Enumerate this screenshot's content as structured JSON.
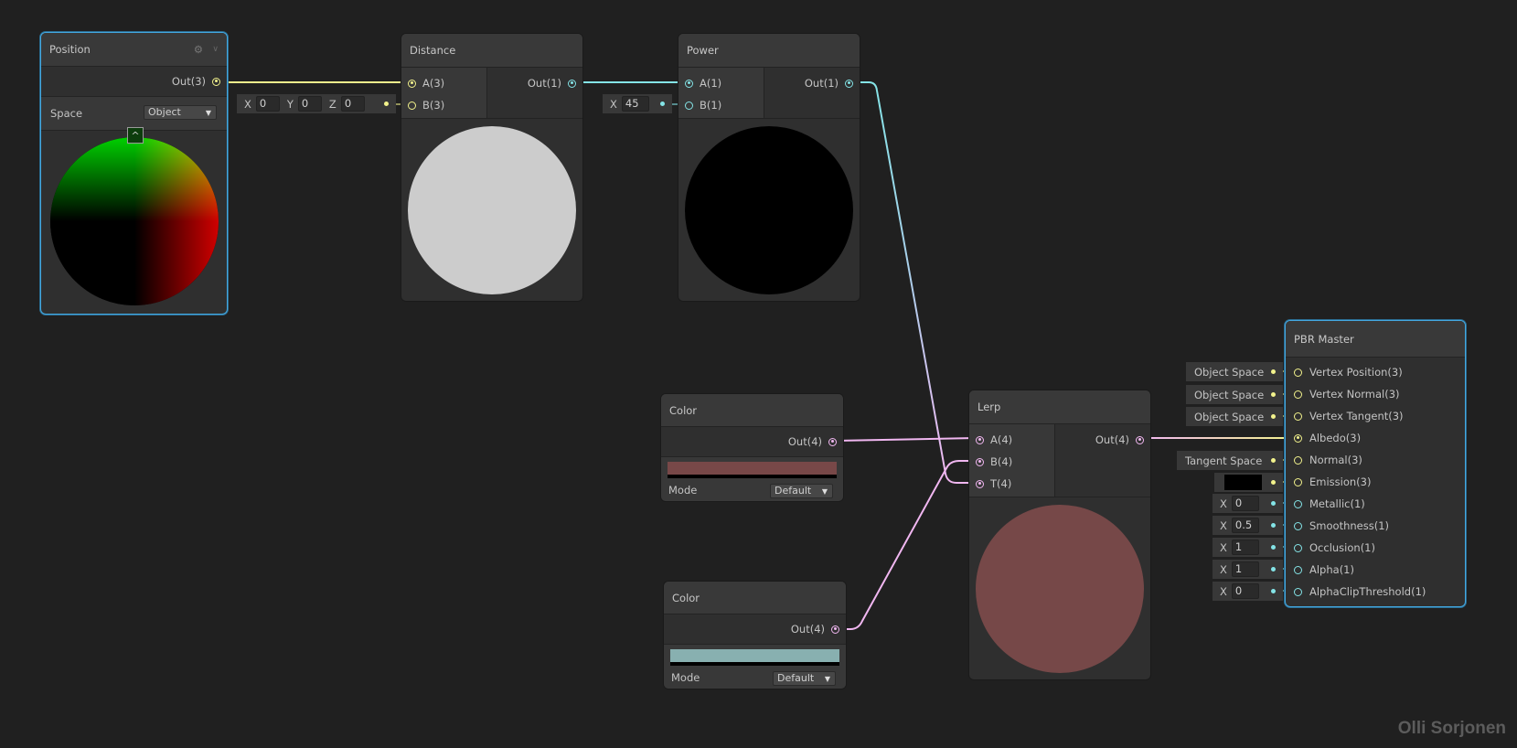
{
  "colors": {
    "vector3": "#f2f28c",
    "vector1": "#84e4e7",
    "vector4": "#f1b7f1",
    "selection": "#44a8e0",
    "color1": "#784848",
    "color2": "#88b0b0",
    "lerp_preview": "#764848"
  },
  "position": {
    "title": "Position",
    "out": "Out(3)",
    "space_label": "Space",
    "space_value": "Object",
    "icons": [
      "gear-icon",
      "chevron-down-icon",
      "collapse-up-icon"
    ]
  },
  "distance": {
    "title": "Distance",
    "in_a": "A(3)",
    "in_b": "B(3)",
    "out": "Out(1)",
    "b_field": {
      "x_label": "X",
      "x": "0",
      "y_label": "Y",
      "y": "0",
      "z_label": "Z",
      "z": "0"
    }
  },
  "power": {
    "title": "Power",
    "in_a": "A(1)",
    "in_b": "B(1)",
    "out": "Out(1)",
    "b_field": {
      "x_label": "X",
      "x": "45"
    }
  },
  "color1": {
    "title": "Color",
    "out": "Out(4)",
    "mode_label": "Mode",
    "mode_value": "Default"
  },
  "color2": {
    "title": "Color",
    "out": "Out(4)",
    "mode_label": "Mode",
    "mode_value": "Default"
  },
  "lerp": {
    "title": "Lerp",
    "in_a": "A(4)",
    "in_b": "B(4)",
    "in_t": "T(4)",
    "out": "Out(4)"
  },
  "pbr": {
    "title": "PBR Master",
    "inputs": [
      {
        "label": "Vertex Position(3)",
        "field": "Object Space"
      },
      {
        "label": "Vertex Normal(3)",
        "field": "Object Space"
      },
      {
        "label": "Vertex Tangent(3)",
        "field": "Object Space"
      },
      {
        "label": "Albedo(3)",
        "field": null
      },
      {
        "label": "Normal(3)",
        "field": "Tangent Space"
      },
      {
        "label": "Emission(3)",
        "field": "color-swatch-black"
      },
      {
        "label": "Metallic(1)",
        "x_label": "X",
        "value": "0"
      },
      {
        "label": "Smoothness(1)",
        "x_label": "X",
        "value": "0.5"
      },
      {
        "label": "Occlusion(1)",
        "x_label": "X",
        "value": "1"
      },
      {
        "label": "Alpha(1)",
        "x_label": "X",
        "value": "1"
      },
      {
        "label": "AlphaClipThreshold(1)",
        "x_label": "X",
        "value": "0"
      }
    ]
  },
  "watermark": "Olli Sorjonen"
}
